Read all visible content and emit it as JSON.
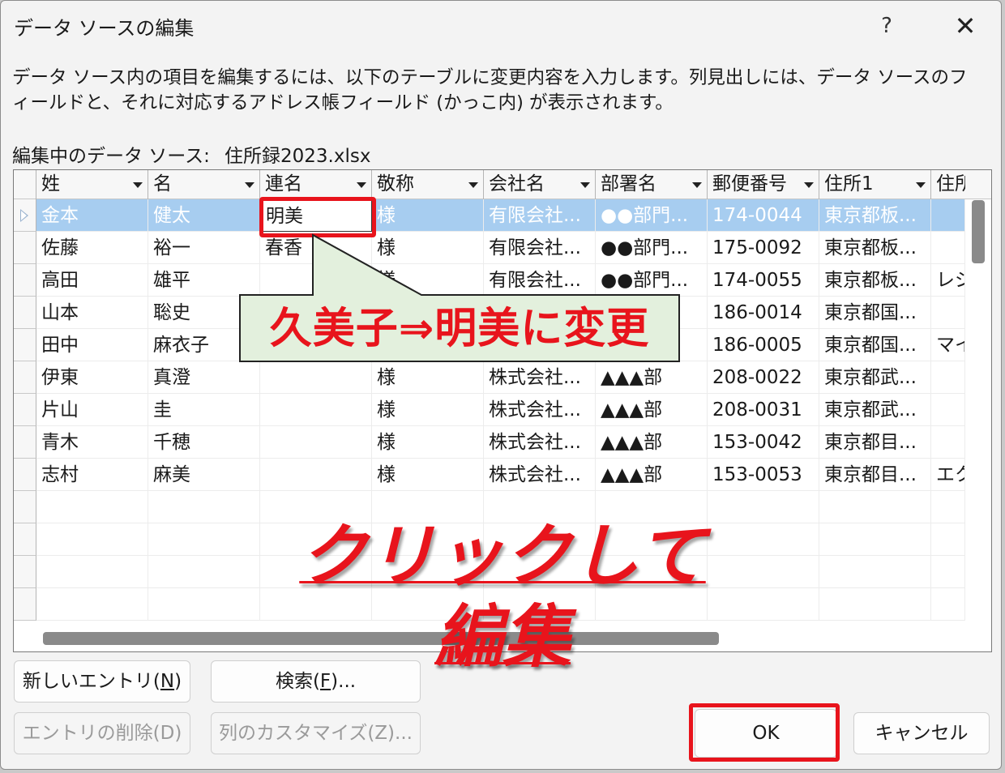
{
  "dialog": {
    "title": "データ ソースの編集",
    "help_label": "?",
    "close_label": "✕",
    "description": "データ ソース内の項目を編集するには、以下のテーブルに変更内容を入力します。列見出しには、データ ソースのフィールドと、それに対応するアドレス帳フィールド (かっこ内) が表示されます。",
    "source_label": "編集中のデータ ソース:",
    "source_file": "住所録2023.xlsx"
  },
  "grid": {
    "columns": [
      "姓",
      "名",
      "連名",
      "敬称",
      "会社名",
      "部署名",
      "郵便番号",
      "住所1",
      "住所"
    ],
    "rows": [
      [
        "金本",
        "健太",
        "明美",
        "様",
        "有限会社...",
        "●●部門...",
        "174-0044",
        "東京都板...",
        ""
      ],
      [
        "佐藤",
        "裕一",
        "春香",
        "様",
        "有限会社...",
        "●●部門...",
        "175-0092",
        "東京都板...",
        ""
      ],
      [
        "高田",
        "雄平",
        "",
        "様",
        "有限会社...",
        "●●部門...",
        "174-0055",
        "東京都板...",
        "レジ"
      ],
      [
        "山本",
        "聡史",
        "",
        "",
        "",
        "...",
        "186-0014",
        "東京都国...",
        ""
      ],
      [
        "田中",
        "麻衣子",
        "",
        "",
        "",
        "...",
        "186-0005",
        "東京都国...",
        "マイ"
      ],
      [
        "伊東",
        "真澄",
        "",
        "様",
        "株式会社...",
        "▲▲▲部",
        "208-0022",
        "東京都武...",
        ""
      ],
      [
        "片山",
        "圭",
        "",
        "様",
        "株式会社...",
        "▲▲▲部",
        "208-0031",
        "東京都武...",
        ""
      ],
      [
        "青木",
        "千穂",
        "",
        "様",
        "株式会社...",
        "▲▲▲部",
        "153-0042",
        "東京都目...",
        ""
      ],
      [
        "志村",
        "麻美",
        "",
        "様",
        "株式会社...",
        "▲▲▲部",
        "153-0053",
        "東京都目...",
        "エク"
      ]
    ]
  },
  "buttons": {
    "new_entry": "新しいエントリ(",
    "new_entry_key": "N",
    "new_entry_end": ")",
    "find": "検索(",
    "find_key": "F",
    "find_end": ")...",
    "delete_entry": "エントリの削除(D)",
    "customize": "列のカスタマイズ(Z)...",
    "ok": "OK",
    "cancel": "キャンセル"
  },
  "annotations": {
    "callout": "久美子⇒明美に変更",
    "caption": "クリックして編集",
    "accent_color": "#e8141c",
    "callout_fill": "#e3f0dd"
  }
}
